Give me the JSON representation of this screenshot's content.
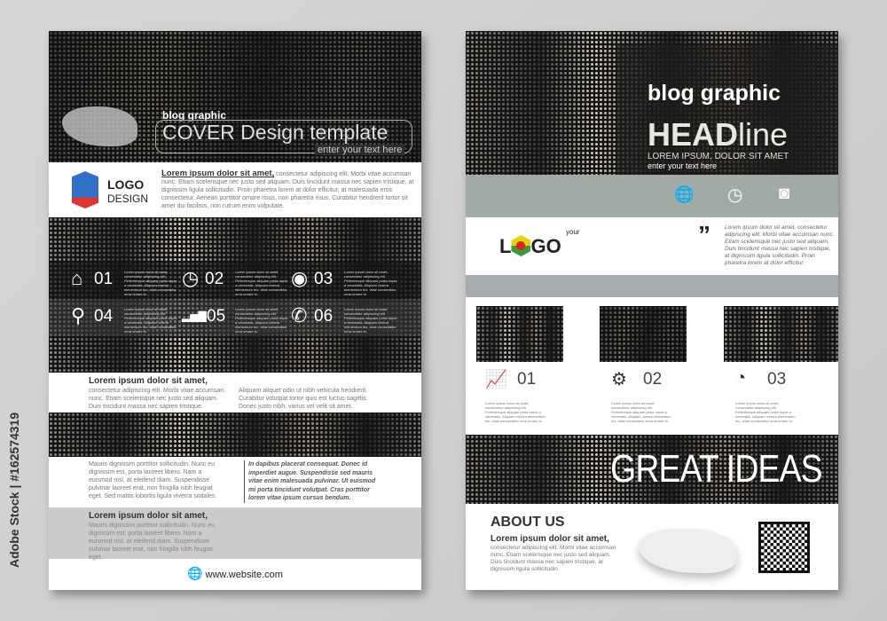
{
  "watermark": "Adobe Stock | #162574319",
  "left": {
    "header": {
      "kicker": "blog graphic",
      "title": "COVER Design template",
      "subtitle": "enter your text here"
    },
    "logo": {
      "line1": "LOGO",
      "line2": "DESIGN"
    },
    "intro": {
      "lead": "Lorem ipsum dolor sit amet,",
      "body": "consectetur adipiscing elit. Morbi vitae accumsan nunc. Etiam scelerisque nec justo sed aliquam. Duis tincidunt massa nec sapien tristique, at dignissim ligula sollicitudin. Proin pharetra lorem at dolor efficitur, at malesuada eros consectetur. Aenean porttitor ornare risus, non pharetra risus. Curabitur hendrerit tortor sit amet dui facilisis, non rutrum enim vulputate."
    },
    "features": [
      {
        "icon": "home-icon",
        "glyph": "⌂",
        "num": "01"
      },
      {
        "icon": "clock-icon",
        "glyph": "◷",
        "num": "02"
      },
      {
        "icon": "camera-icon",
        "glyph": "◉",
        "num": "03"
      },
      {
        "icon": "location-pin-icon",
        "glyph": "⚲",
        "num": "04"
      },
      {
        "icon": "bar-chart-icon",
        "glyph": "▂▅▇",
        "num": "05"
      },
      {
        "icon": "phone-icon",
        "glyph": "✆",
        "num": "06"
      }
    ],
    "feature_text": "Lorem ipsum dolor sit amet, consectetur adipiscing elit. Pellentesque aliquam porta turpis a venenatis. Aliquam viverra elementum leo, vitae consectetur urna ornare in.",
    "section2": {
      "title": "Lorem ipsum dolor sit amet,",
      "col1": "consectetur adipiscing elit. Morbi vitae accumsan nunc. Etiam scelerisque nec justo sed aliquam. Duis tincidunt massa nec sapien tristique.",
      "col2": "Aliquam aliquet odio ut nibh vehicula hendrerit. Curabitur volutpat tortor quis est luctus sagittis. Donec justo nibh, varius vel velit sit amet."
    },
    "section3": {
      "col1": "Mauris dignissim porttitor sollicitudin. Nunc eu dignissim est, porta laoreet libero. Nam a euismod nisl, at eleifend diam. Suspendisse pulvinar laoreet erat, non fringilla nibh feugiat eget. Sed mattis lobortis ligula viverra sodales.",
      "quote": "In dapibus placerat consequat. Donec id imperdiet augue. Suspendisse sed mauris vitae enim malesuada pulvinar. Ut euismod mi porta tincidunt volutpat. Cras porttitor lorem vitae ipsum cursus bendum."
    },
    "section4": {
      "title": "Lorem ipsum dolor sit amet,",
      "body": "Mauris dignissim porttitor sollicitudin. Nunc eu dignissim est, porta laoreet libero. Nam a euismod nisl, at eleifend diam. Suspendisse pulvinar laoreet erat, non fringilla nibh feugiat eget."
    },
    "footer": {
      "website": "www.website.com"
    }
  },
  "right": {
    "header": {
      "kicker": "blog graphic",
      "title_bold": "HEAD",
      "title_light": "line",
      "subtitle": "LOREM IPSUM, DOLOR SIT AMET",
      "tagline": "enter your text here"
    },
    "band_icons": [
      "globe-icon",
      "clock-icon",
      "camera-icon"
    ],
    "logo": {
      "your": "your",
      "word_l": "L",
      "word_go": "GO"
    },
    "quote": "Lorem ipsum dolor sit amet, consectetur adipiscing elit. Morbi vitae accumsan nunc. Etiam scelerisque nec justo sed aliquam. Duis tincidunt massa nec sapien tristique, at dignissim ligula sollicitudin. Proin pharetra lorem at dolor efficitur.",
    "steps": [
      {
        "icon": "growth-chart-icon",
        "glyph": "📈",
        "num": "01"
      },
      {
        "icon": "gears-icon",
        "glyph": "⚙",
        "num": "02"
      },
      {
        "icon": "stopwatch-icon",
        "glyph": "◔",
        "num": "03"
      }
    ],
    "step_text": "Lorem ipsum dolor sit amet, consectetur adipiscing elit. Pellentesque aliquam porta turpis a venenatis. Aliquam viverra elementum leo, vitae consectetur urna ornare in.",
    "banner": "GREAT IDEAS",
    "about": {
      "title": "ABOUT US",
      "lead": "Lorem ipsum dolor sit amet,",
      "body": "consectetur adipiscing elit. Morbi vitae accumsan nunc. Etiam scelerisque nec justo sed aliquam. Duis tincidunt massa nec sapien tristique, at dignissim ligula sollicitudin."
    }
  }
}
